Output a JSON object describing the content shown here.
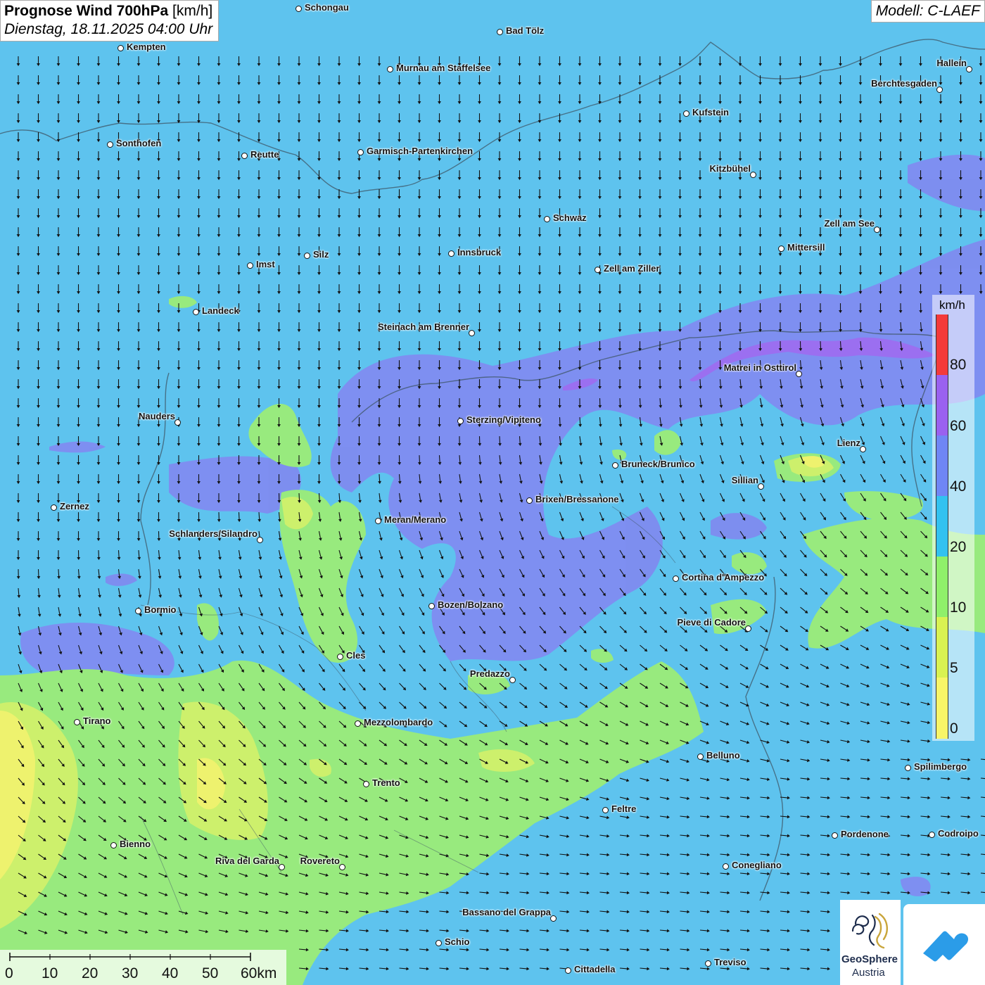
{
  "header": {
    "title_bold": "Prognose Wind 700hPa",
    "title_unit": "[km/h]",
    "datetime": "Dienstag, 18.11.2025 04:00 Uhr",
    "model": "Modell: C-LAEF"
  },
  "legend": {
    "unit": "km/h",
    "ticks": [
      "80",
      "60",
      "40",
      "20",
      "10",
      "5",
      "0"
    ],
    "colors": [
      "#f43a3a",
      "#9a61f0",
      "#6f86f5",
      "#32c2f0",
      "#8ff06a",
      "#d9f251",
      "#f8f568"
    ]
  },
  "scalebar": {
    "labels": [
      "0",
      "10",
      "20",
      "30",
      "40",
      "50",
      "60km"
    ]
  },
  "logo": {
    "name_line1": "GeoSphere",
    "name_line2": "Austria"
  },
  "map_colors": {
    "base": "#5ec3ee",
    "band_40_60": "#7f8cf0",
    "band_60_80": "#9b6ff0",
    "band_10_20": "#98ea7e",
    "band_5_10": "#cdf06c",
    "band_0_5": "#eef26e"
  },
  "places": [
    {
      "name": "Schongau"
    },
    {
      "name": "Bad Tölz"
    },
    {
      "name": "Kempten"
    },
    {
      "name": "Murnau am Staffelsee"
    },
    {
      "name": "Hallein"
    },
    {
      "name": "Berchtesgaden"
    },
    {
      "name": "Kufstein"
    },
    {
      "name": "Sonthofen"
    },
    {
      "name": "Reutte"
    },
    {
      "name": "Garmisch-Partenkirchen"
    },
    {
      "name": "Kitzbühel"
    },
    {
      "name": "Schwaz"
    },
    {
      "name": "Zell am See"
    },
    {
      "name": "Innsbruck"
    },
    {
      "name": "Mittersill"
    },
    {
      "name": "Silz"
    },
    {
      "name": "Imst"
    },
    {
      "name": "Zell am Ziller"
    },
    {
      "name": "Landeck"
    },
    {
      "name": "Steinach am Brenner"
    },
    {
      "name": "Matrei in Osttirol"
    },
    {
      "name": "Nauders"
    },
    {
      "name": "Sterzing/Vipiteno"
    },
    {
      "name": "Lienz"
    },
    {
      "name": "Bruneck/Brunico"
    },
    {
      "name": "Sillian"
    },
    {
      "name": "Brixen/Bressanone"
    },
    {
      "name": "Zernez"
    },
    {
      "name": "Meran/Merano"
    },
    {
      "name": "Schlanders/Silandro"
    },
    {
      "name": "Cortina d'Ampezzo"
    },
    {
      "name": "Bozen/Bolzano"
    },
    {
      "name": "Bormio"
    },
    {
      "name": "Pieve di Cadore"
    },
    {
      "name": "Cles"
    },
    {
      "name": "Predazzo"
    },
    {
      "name": "Tirano"
    },
    {
      "name": "Mezzolombardo"
    },
    {
      "name": "Belluno"
    },
    {
      "name": "Spilimbergo"
    },
    {
      "name": "Trento"
    },
    {
      "name": "Feltre"
    },
    {
      "name": "Pordenone"
    },
    {
      "name": "Codroipo"
    },
    {
      "name": "Bienno"
    },
    {
      "name": "Riva del Garda"
    },
    {
      "name": "Rovereto"
    },
    {
      "name": "Conegliano"
    },
    {
      "name": "Bassano del Grappa"
    },
    {
      "name": "Schio"
    },
    {
      "name": "Treviso"
    },
    {
      "name": "Cittadella"
    }
  ]
}
